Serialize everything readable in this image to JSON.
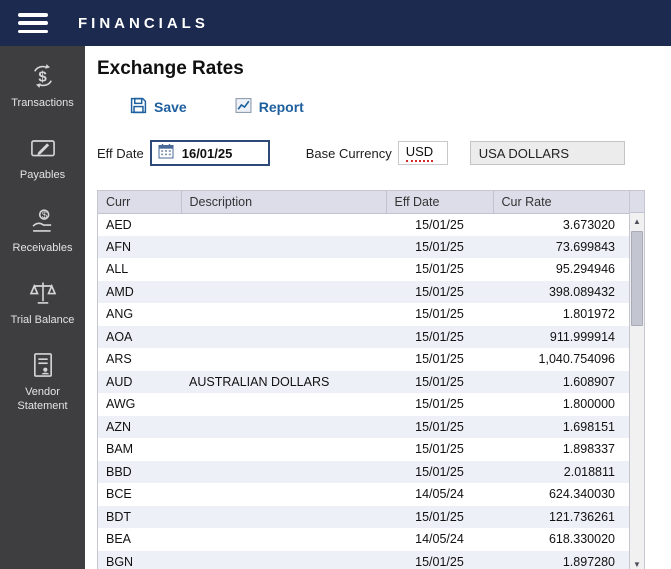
{
  "topbar": {
    "title": "FINANCIALS"
  },
  "sidebar": {
    "items": [
      {
        "label": "Transactions",
        "icon": "transactions-icon"
      },
      {
        "label": "Payables",
        "icon": "payables-icon"
      },
      {
        "label": "Receivables",
        "icon": "receivables-icon"
      },
      {
        "label": "Trial Balance",
        "icon": "trial-balance-icon"
      },
      {
        "label": "Vendor Statement",
        "icon": "vendor-statement-icon"
      }
    ]
  },
  "main": {
    "title": "Exchange Rates",
    "toolbar": {
      "save_label": "Save",
      "save_icon": "save-icon",
      "report_label": "Report",
      "report_icon": "report-icon"
    },
    "form": {
      "eff_date_label": "Eff Date",
      "eff_date_value": "16/01/25",
      "calendar_icon": "calendar-icon",
      "base_currency_label": "Base Currency",
      "base_currency_code": "USD",
      "base_currency_name": "USA DOLLARS"
    },
    "table": {
      "columns": [
        "Curr",
        "Description",
        "Eff Date",
        "Cur Rate"
      ],
      "rows": [
        {
          "curr": "AED",
          "description": "",
          "eff_date": "15/01/25",
          "cur_rate": "3.673020"
        },
        {
          "curr": "AFN",
          "description": "",
          "eff_date": "15/01/25",
          "cur_rate": "73.699843"
        },
        {
          "curr": "ALL",
          "description": "",
          "eff_date": "15/01/25",
          "cur_rate": "95.294946"
        },
        {
          "curr": "AMD",
          "description": "",
          "eff_date": "15/01/25",
          "cur_rate": "398.089432"
        },
        {
          "curr": "ANG",
          "description": "",
          "eff_date": "15/01/25",
          "cur_rate": "1.801972"
        },
        {
          "curr": "AOA",
          "description": "",
          "eff_date": "15/01/25",
          "cur_rate": "911.999914"
        },
        {
          "curr": "ARS",
          "description": "",
          "eff_date": "15/01/25",
          "cur_rate": "1,040.754096"
        },
        {
          "curr": "AUD",
          "description": "AUSTRALIAN DOLLARS",
          "eff_date": "15/01/25",
          "cur_rate": "1.608907"
        },
        {
          "curr": "AWG",
          "description": "",
          "eff_date": "15/01/25",
          "cur_rate": "1.800000"
        },
        {
          "curr": "AZN",
          "description": "",
          "eff_date": "15/01/25",
          "cur_rate": "1.698151"
        },
        {
          "curr": "BAM",
          "description": "",
          "eff_date": "15/01/25",
          "cur_rate": "1.898337"
        },
        {
          "curr": "BBD",
          "description": "",
          "eff_date": "15/01/25",
          "cur_rate": "2.018811"
        },
        {
          "curr": "BCE",
          "description": "",
          "eff_date": "14/05/24",
          "cur_rate": "624.340030"
        },
        {
          "curr": "BDT",
          "description": "",
          "eff_date": "15/01/25",
          "cur_rate": "121.736261"
        },
        {
          "curr": "BEA",
          "description": "",
          "eff_date": "14/05/24",
          "cur_rate": "618.330020"
        },
        {
          "curr": "BGN",
          "description": "",
          "eff_date": "15/01/25",
          "cur_rate": "1.897280"
        }
      ]
    },
    "scrollbar": {
      "up_icon": "▲",
      "down_icon": "▼"
    }
  },
  "colors": {
    "topbar_bg": "#1b2a4e",
    "sidebar_bg": "#3e3e40",
    "accent_blue": "#1e5f9e",
    "table_header_bg": "#dcdde9",
    "row_alt_bg": "#eef0f8",
    "spellcheck_red": "#d42a2a"
  }
}
